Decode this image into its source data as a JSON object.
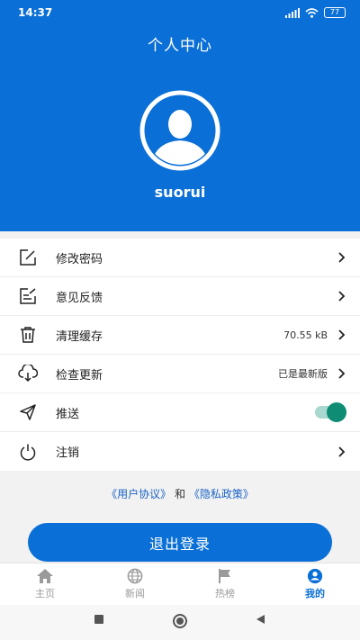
{
  "status_bar": {
    "time": "14:37",
    "battery": "77"
  },
  "header": {
    "title": "个人中心",
    "username": "suorui"
  },
  "menu": [
    {
      "label": "修改密码",
      "icon": "edit-icon"
    },
    {
      "label": "意见反馈",
      "icon": "feedback-icon"
    },
    {
      "label": "清理缓存",
      "icon": "trash-icon",
      "value": "70.55 kB"
    },
    {
      "label": "检查更新",
      "icon": "cloud-download-icon",
      "value": "已是最新版"
    },
    {
      "label": "推送",
      "icon": "send-icon",
      "toggle_on": true
    },
    {
      "label": "注销",
      "icon": "power-icon"
    }
  ],
  "policy": {
    "user_agreement": "《用户协议》",
    "and": "和",
    "privacy_policy": "《隐私政策》"
  },
  "logout_button": "退出登录",
  "tabs": [
    {
      "label": "主页",
      "icon": "home-icon"
    },
    {
      "label": "新闻",
      "icon": "globe-icon"
    },
    {
      "label": "热榜",
      "icon": "flag-icon"
    },
    {
      "label": "我的",
      "icon": "user-icon",
      "active": true
    }
  ],
  "colors": {
    "primary": "#0a6fd6",
    "toggle": "#0f8c74",
    "link": "#1b63c4"
  }
}
